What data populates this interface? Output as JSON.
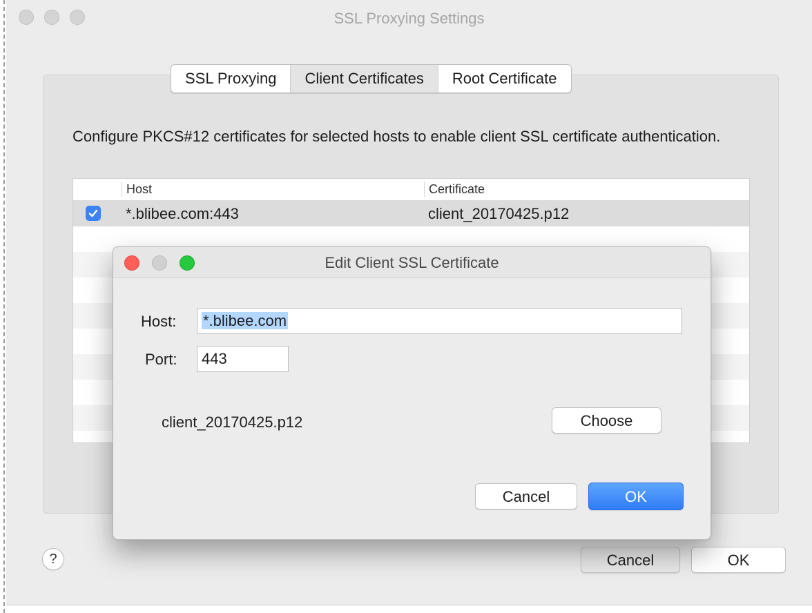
{
  "main_window": {
    "title": "SSL Proxying Settings",
    "tabs": [
      {
        "label": "SSL Proxying",
        "active": false
      },
      {
        "label": "Client Certificates",
        "active": true
      },
      {
        "label": "Root Certificate",
        "active": false
      }
    ],
    "description": "Configure PKCS#12 certificates for selected hosts to enable client SSL certificate authentication.",
    "table": {
      "columns": [
        "Host",
        "Certificate"
      ],
      "rows": [
        {
          "enabled": true,
          "host": "*.blibee.com:443",
          "certificate": "client_20170425.p12"
        }
      ]
    },
    "help_label": "?",
    "buttons": {
      "cancel": "Cancel",
      "ok": "OK"
    }
  },
  "dialog": {
    "title": "Edit Client SSL Certificate",
    "host_label": "Host:",
    "host_value": "*.blibee.com",
    "port_label": "Port:",
    "port_value": "443",
    "certificate_file": "client_20170425.p12",
    "choose_label": "Choose",
    "cancel_label": "Cancel",
    "ok_label": "OK"
  },
  "colors": {
    "accent": "#2f7cf6",
    "checkbox": "#3b82f6",
    "selection": "#b3d7ff",
    "close": "#fe5f57",
    "zoom": "#28c840"
  }
}
